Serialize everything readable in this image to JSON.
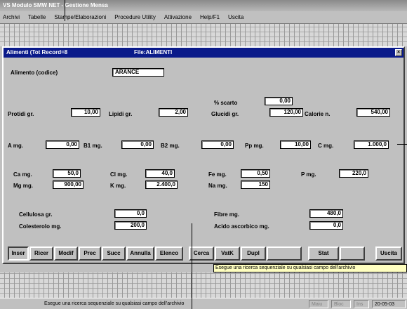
{
  "app_title": "VS Modulo SMW NET - Gestione Mensa",
  "menu": [
    "Archivi",
    "Tabelle",
    "Stampe/Elaborazioni",
    "Procedure Utility",
    "Attivazione",
    "Help/F1",
    "Uscita"
  ],
  "window": {
    "title": "Alimenti (Tot Record=8",
    "file": "File:ALIMENTI",
    "close_glyph": "×"
  },
  "form": {
    "alimento_label": "Alimento (codice)",
    "alimento_value": "ARANCE",
    "scarto_label": "% scarto",
    "scarto_value": "0,00",
    "row1": [
      {
        "label": "Protidi gr.",
        "value": "10,00"
      },
      {
        "label": "Lipidi gr.",
        "value": "2,00"
      },
      {
        "label": "Glucidi gr.",
        "value": "120,00"
      },
      {
        "label": "Calorie n.",
        "value": "540,00"
      }
    ],
    "row2": [
      {
        "label": "A mg.",
        "value": "0,00"
      },
      {
        "label": "B1 mg.",
        "value": "0,00"
      },
      {
        "label": "B2 mg.",
        "value": "0,00"
      },
      {
        "label": "Pp mg.",
        "value": "10,00"
      },
      {
        "label": "C mg.",
        "value": "1.000,0"
      }
    ],
    "row3": [
      {
        "label": "Ca mg.",
        "value": "50,0"
      },
      {
        "label": "Cl mg.",
        "value": "40,0"
      },
      {
        "label": "Fe mg.",
        "value": "0,50"
      },
      {
        "label": "P mg.",
        "value": "220,0"
      }
    ],
    "row4": [
      {
        "label": "Mg mg.",
        "value": "900,00"
      },
      {
        "label": "K mg.",
        "value": "2.400,0"
      },
      {
        "label": "Na mg.",
        "value": "150"
      }
    ],
    "row5": [
      {
        "label": "Cellulosa gr.",
        "value": "0,0"
      },
      {
        "label": "Fibre mg.",
        "value": "480,0"
      }
    ],
    "row6": [
      {
        "label": "Colesterolo mg.",
        "value": "200,0"
      },
      {
        "label": "Acido ascorbico mg.",
        "value": "0,0"
      }
    ]
  },
  "buttons": [
    "Inser",
    "Ricer",
    "Modif",
    "Prec",
    "Succ",
    "Annulla",
    "Elenco",
    "Cerca",
    "VatK",
    "Dupl",
    "",
    "Stat",
    "",
    "Uscita"
  ],
  "tooltip": "Esegue una ricerca sequenziale su qualsiasi campo dell'archivio",
  "status": {
    "message": "Esegue una ricerca sequenziale su qualsiasi campo dell'archivio",
    "caps": "Maiu",
    "num": "Bloc",
    "ins": "Ins",
    "date": "20-05-03"
  }
}
